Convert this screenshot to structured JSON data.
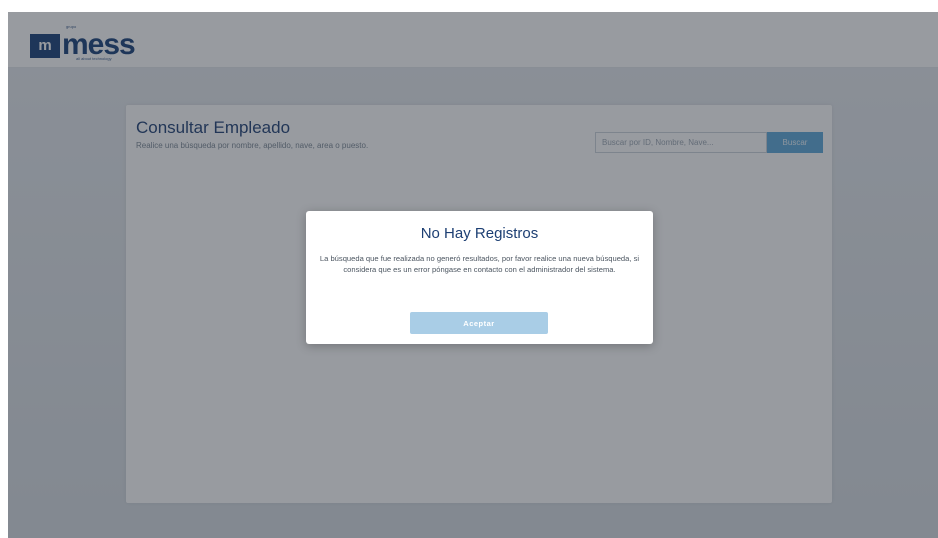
{
  "header": {
    "logo": {
      "mark_letter": "m",
      "wordmark": "mess",
      "top_tag": "grupo",
      "tagline": "all about technology"
    }
  },
  "employee_search": {
    "title": "Consultar Empleado",
    "subtitle": "Realice una búsqueda por nombre, apellido, nave, area o puesto.",
    "search": {
      "placeholder": "Buscar por ID, Nombre, Nave...",
      "value": ""
    },
    "search_button_label": "Buscar"
  },
  "dialog": {
    "title": "No Hay Registros",
    "message": "La búsqueda que fue realizada no generó resultados, por favor realice una nueva búsqueda, si considera que es un error póngase en contacto con el administrador del sistema.",
    "accept_label": "Aceptar"
  },
  "colors": {
    "brand_navy": "#163f78",
    "title_blue": "#1d3f73",
    "button_blue": "#5aa7d8",
    "modal_button": "#a9cde6",
    "overlay": "rgba(40,47,56,0.48)"
  }
}
